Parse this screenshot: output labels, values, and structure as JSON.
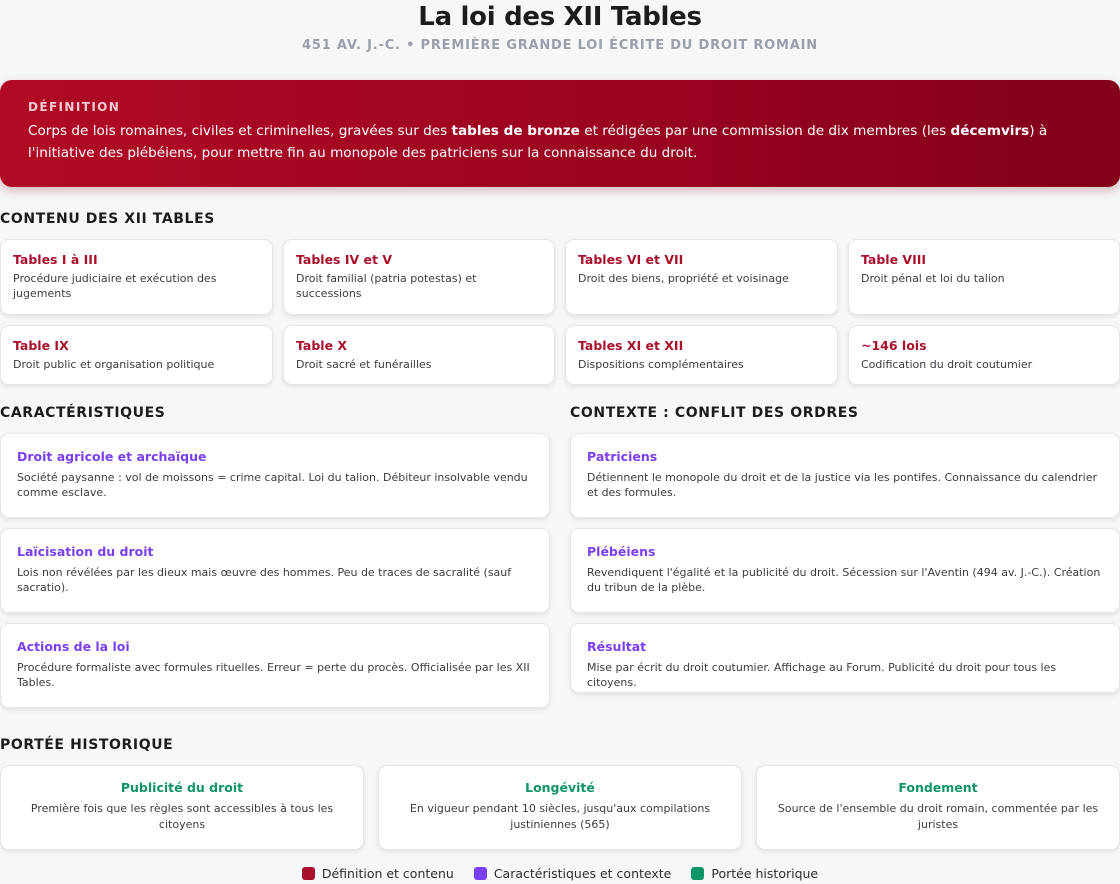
{
  "header": {
    "title": "La loi des XII Tables",
    "subtitle": "451 AV. J.-C. • PREMIÈRE GRANDE LOI ÉCRITE DU DROIT ROMAIN"
  },
  "definition": {
    "label": "DÉFINITION",
    "text_1": "Corps de lois romaines, civiles et criminelles, gravées sur des ",
    "bold_1": "tables de bronze",
    "text_2": " et rédigées par une commission de dix membres (les ",
    "bold_2": "décemvirs",
    "text_3": ") à l'initiative des plébéiens, pour mettre fin au monopole des patriciens sur la connaissance du droit."
  },
  "contenu": {
    "heading": "CONTENU DES XII TABLES",
    "cards": [
      {
        "title": "Tables I à III",
        "desc": "Procédure judiciaire et exécution des jugements"
      },
      {
        "title": "Tables IV et V",
        "desc": "Droit familial (patria potestas) et successions"
      },
      {
        "title": "Tables VI et VII",
        "desc": "Droit des biens, propriété et voisinage"
      },
      {
        "title": "Table VIII",
        "desc": "Droit pénal et loi du talion"
      },
      {
        "title": "Table IX",
        "desc": "Droit public et organisation politique"
      },
      {
        "title": "Table X",
        "desc": "Droit sacré et funérailles"
      },
      {
        "title": "Tables XI et XII",
        "desc": "Dispositions complémentaires"
      },
      {
        "title": "~146 lois",
        "desc": "Codification du droit coutumier"
      }
    ]
  },
  "caracteristiques": {
    "heading": "CARACTÉRISTIQUES",
    "cards": [
      {
        "title": "Droit agricole et archaïque",
        "desc": "Société paysanne : vol de moissons = crime capital. Loi du talion. Débiteur insolvable vendu comme esclave."
      },
      {
        "title": "Laïcisation du droit",
        "desc": "Lois non révélées par les dieux mais œuvre des hommes. Peu de traces de sacralité (sauf sacratio)."
      },
      {
        "title": "Actions de la loi",
        "desc": "Procédure formaliste avec formules rituelles. Erreur = perte du procès. Officialisée par les XII Tables."
      }
    ]
  },
  "contexte": {
    "heading": "CONTEXTE : CONFLIT DES ORDRES",
    "cards": [
      {
        "title": "Patriciens",
        "desc": "Détiennent le monopole du droit et de la justice via les pontifes. Connaissance du calendrier et des formules."
      },
      {
        "title": "Plébéiens",
        "desc": "Revendiquent l'égalité et la publicité du droit. Sécession sur l'Aventin (494 av. J.-C.). Création du tribun de la plèbe."
      },
      {
        "title": "Résultat",
        "desc": "Mise par écrit du droit coutumier. Affichage au Forum. Publicité du droit pour tous les citoyens."
      }
    ]
  },
  "portee": {
    "heading": "PORTÉE HISTORIQUE",
    "cards": [
      {
        "title": "Publicité du droit",
        "desc": "Première fois que les règles sont accessibles à tous les citoyens"
      },
      {
        "title": "Longévité",
        "desc": "En vigueur pendant 10 siècles, jusqu'aux compilations justiniennes (565)"
      },
      {
        "title": "Fondement",
        "desc": "Source de l'ensemble du droit romain, commentée par les juristes"
      }
    ]
  },
  "legend": [
    {
      "label": "Définition et contenu",
      "color": "#a8102c"
    },
    {
      "label": "Caractéristiques et contexte",
      "color": "#7a3ff0"
    },
    {
      "label": "Portée historique",
      "color": "#0e9467"
    }
  ]
}
